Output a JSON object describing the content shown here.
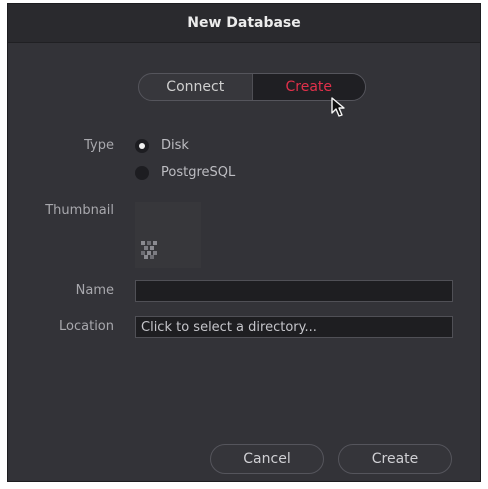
{
  "dialog": {
    "title": "New Database"
  },
  "mode_toggle": {
    "options": [
      "Connect",
      "Create"
    ],
    "selected": "Create"
  },
  "form": {
    "type": {
      "label": "Type",
      "options": [
        {
          "label": "Disk",
          "checked": true
        },
        {
          "label": "PostgreSQL",
          "checked": false
        }
      ]
    },
    "thumbnail": {
      "label": "Thumbnail",
      "icon": "image-placeholder-icon"
    },
    "name": {
      "label": "Name",
      "value": ""
    },
    "location": {
      "label": "Location",
      "value": "Click to select a directory..."
    }
  },
  "buttons": {
    "cancel": "Cancel",
    "create": "Create"
  },
  "colors": {
    "accent": "#e0304a",
    "dialog_bg": "#333338",
    "field_bg": "#1e1e21"
  }
}
